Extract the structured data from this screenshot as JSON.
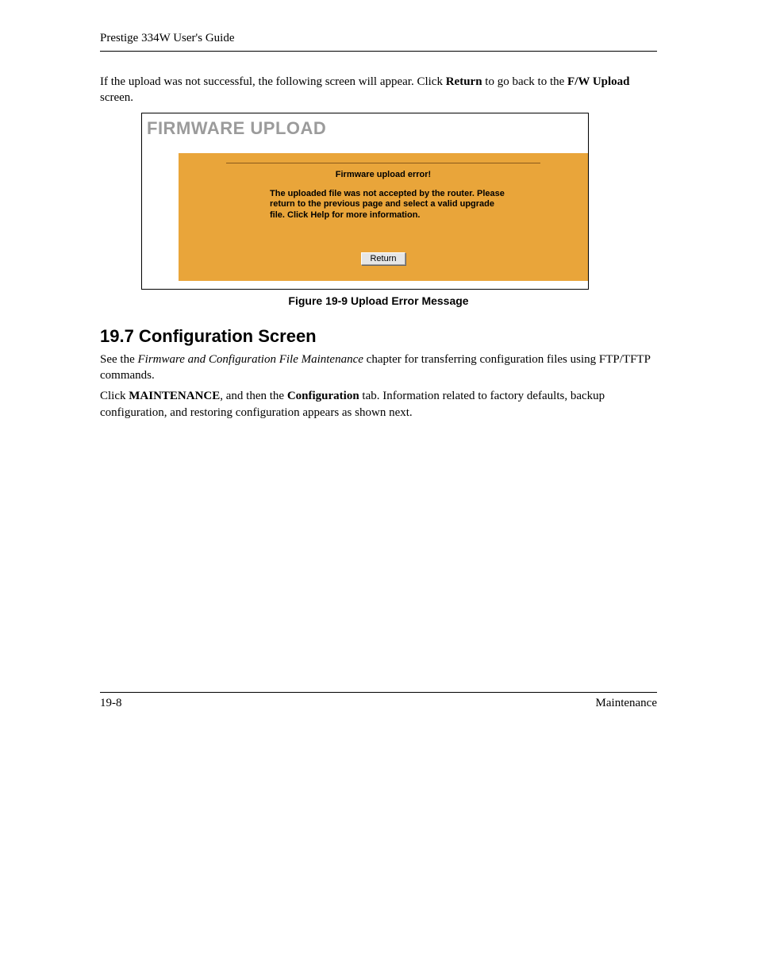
{
  "header": {
    "title": "Prestige 334W User's Guide"
  },
  "intro": {
    "part1": "If the upload was not successful, the following screen will appear.  Click ",
    "return_bold": "Return",
    "part2": " to go back to the ",
    "fw_bold": "F/W Upload",
    "part3": " screen."
  },
  "firmware_panel": {
    "title": "FIRMWARE UPLOAD",
    "error_title": "Firmware upload error!",
    "error_message": "The uploaded file was not accepted by the router. Please return to the previous page and select a valid upgrade file. Click Help for more information.",
    "return_button": "Return"
  },
  "figure_caption": "Figure 19-9 Upload Error Message",
  "section": {
    "heading": "19.7  Configuration Screen",
    "p1_a": "See the ",
    "p1_italic": "Firmware and Configuration File Maintenance",
    "p1_b": " chapter for transferring configuration files using FTP/TFTP commands.",
    "p2_a": "Click ",
    "p2_bold1": "MAINTENANCE",
    "p2_b": ", and then the ",
    "p2_bold2": "Configuration",
    "p2_c": " tab. Information related to factory defaults, backup configuration, and restoring configuration appears as shown next."
  },
  "footer": {
    "page": "19-8",
    "section": "Maintenance"
  }
}
